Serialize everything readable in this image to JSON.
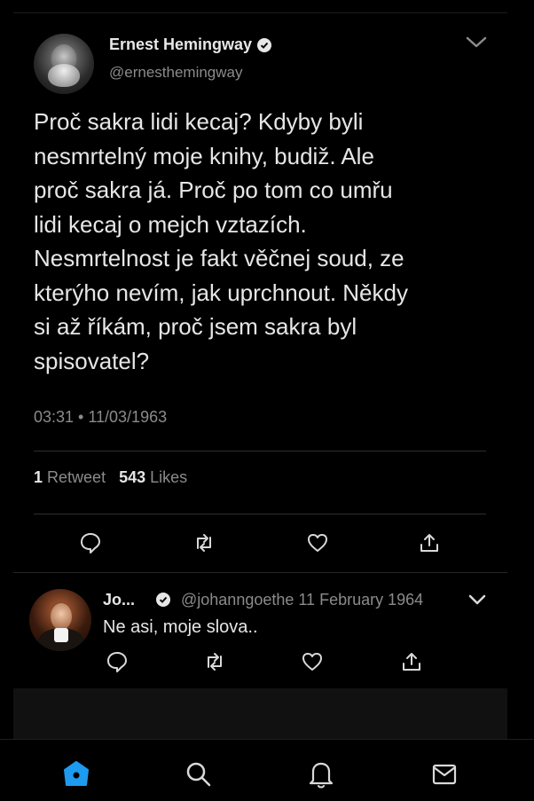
{
  "tweet": {
    "author_name": "Ernest Hemingway",
    "handle": "@ernesthemingway",
    "text": "Proč sakra lidi kecaj? Kdyby byli\nnesmrtelný moje knihy, budiž. Ale\nproč sakra já. Proč po tom co umřu\nlidi kecaj o mejch vztazích.\nNesmrtelnost je fakt věčnej soud, ze\nkterýho nevím, jak uprchnout. Někdy\nsi až říkám, proč jsem sakra byl\nspisovatel?",
    "time": "03:31 • 11/03/1963",
    "retweet_count": "1",
    "retweet_label": "Retweet",
    "like_count": "543",
    "like_label": "Likes"
  },
  "reply": {
    "author_name": "Jo...",
    "handle_date": "@johanngoethe 11 February 1964",
    "text": "Ne asi, moje slova.."
  },
  "icons": [
    "chevron-down-icon",
    "verified-icon",
    "reply-icon",
    "retweet-icon",
    "like-icon",
    "share-icon",
    "home-icon",
    "search-icon",
    "notifications-icon",
    "messages-icon"
  ],
  "colors": {
    "background": "#000000",
    "text": "#e6e6e6",
    "muted": "#8b8b8b",
    "accent": "#1d9bf0"
  }
}
